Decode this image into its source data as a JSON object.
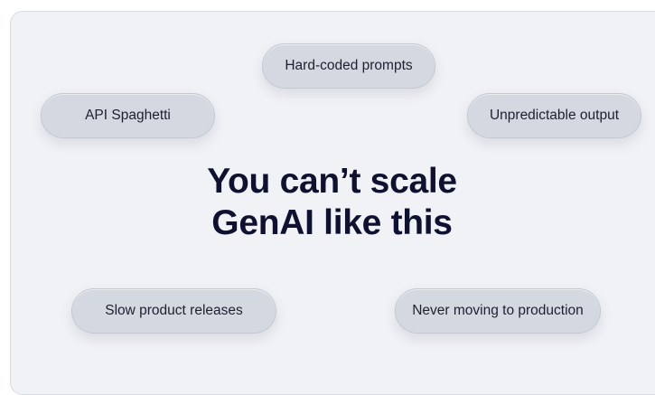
{
  "pills": {
    "hardcoded_prompts": "Hard-coded prompts",
    "api_spaghetti": "API Spaghetti",
    "unpredictable_output": "Unpredictable output",
    "slow_releases": "Slow product releases",
    "never_production": "Never moving to production"
  },
  "headline": {
    "line1": "You can’t scale",
    "line2": "GenAI like this"
  },
  "colors": {
    "card_background": "#f1f2f6",
    "pill_background": "#d4d8e1",
    "headline_text": "#0e1230",
    "pill_text": "#1d2030"
  }
}
